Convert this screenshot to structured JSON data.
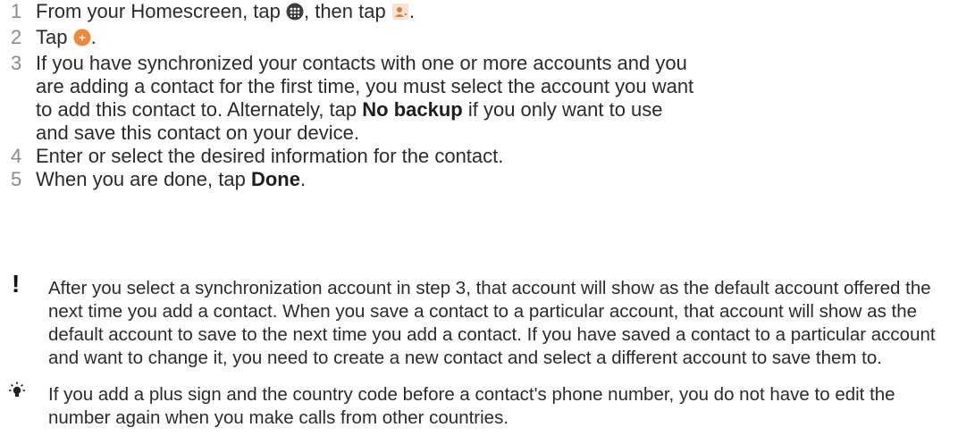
{
  "steps": [
    {
      "num": "1",
      "pre": "From your Homescreen, tap ",
      "mid": ", then tap ",
      "post": ".",
      "icons": [
        "apps-icon",
        "contacts-icon"
      ]
    },
    {
      "num": "2",
      "pre": "Tap ",
      "post": ".",
      "icons": [
        "add-contact-icon"
      ]
    },
    {
      "num": "3",
      "pre": "If you have synchronized your contacts with one or more accounts and you are adding a contact for the first time, you must select the account you want to add this contact to. Alternately, tap ",
      "bold": "No backup",
      "post": " if you only want to use and save this contact on your device."
    },
    {
      "num": "4",
      "text": "Enter or select the desired information for the contact."
    },
    {
      "num": "5",
      "pre": "When you are done, tap ",
      "bold": "Done",
      "post": "."
    }
  ],
  "warning": {
    "icon": "exclamation-icon",
    "text": "After you select a synchronization account in step 3, that account will show as the default account offered the next time you add a contact. When you save a contact to a particular account, that account will show as the default account to save to the next time you add a contact. If you have saved a contact to a particular account and want to change it, you need to create a new contact and select a different account to save them to."
  },
  "tip": {
    "icon": "lightbulb-icon",
    "text": "If you add a plus sign and the country code before a contact's phone number, you do not have to edit the number again when you make calls from other countries."
  },
  "colors": {
    "text": "#2b2b2b",
    "step_number": "#8a8a8a",
    "accent_orange": "#f0883c",
    "apps_icon": "#3c3c3c"
  }
}
